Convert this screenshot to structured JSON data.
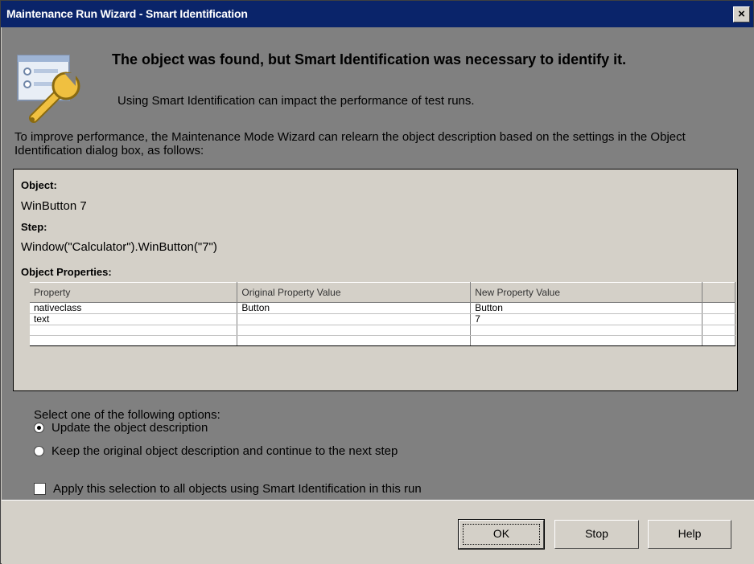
{
  "window": {
    "title": "Maintenance Run Wizard - Smart Identification",
    "close_glyph": "×"
  },
  "header": {
    "title": "The object was found, but Smart Identification was necessary to identify it.",
    "subtitle": "Using Smart Identification can impact the performance of test runs.",
    "icon": "wrench-settings-icon"
  },
  "intro": "To improve performance, the Maintenance Mode Wizard can relearn the object description based on the settings in the Object Identification dialog box, as follows:",
  "details": {
    "object_label": "Object:",
    "object_value": "WinButton 7",
    "step_label": "Step:",
    "step_value": "Window(\"Calculator\").WinButton(\"7\")",
    "props_label": "Object Properties:"
  },
  "table": {
    "headers": [
      "Property",
      "Original Property Value",
      "New Property Value"
    ],
    "rows": [
      [
        "nativeclass",
        "Button",
        "Button"
      ],
      [
        "text",
        "",
        "7"
      ],
      [
        "",
        "",
        ""
      ],
      [
        "",
        "",
        ""
      ]
    ]
  },
  "options": {
    "prompt": "Select one of the following options:",
    "update_label": "Update the object description",
    "keep_label": "Keep the original object description and continue to the next step",
    "apply_label": "Apply this selection to all objects using Smart Identification in this run",
    "selected": "update",
    "apply_checked": false
  },
  "buttons": {
    "ok": "OK",
    "stop": "Stop",
    "help": "Help"
  },
  "colors": {
    "titlebar": "#0a246a",
    "content_bg": "#808080",
    "panel_bg": "#d4d0c8"
  }
}
